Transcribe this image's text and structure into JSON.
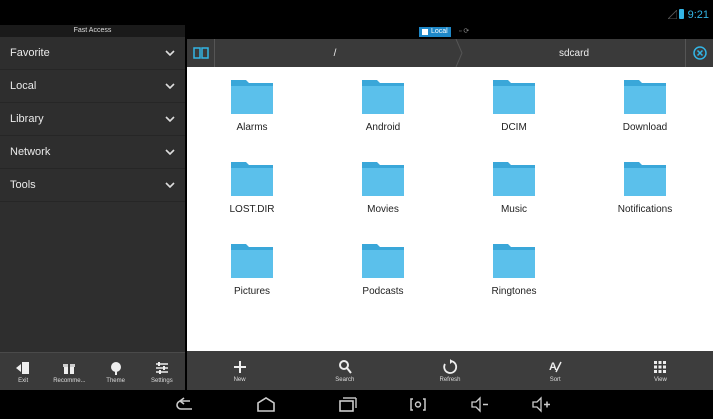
{
  "status": {
    "time": "9:21",
    "accent": "#33b5e5"
  },
  "left_panel": {
    "header": "Fast Access",
    "items": [
      {
        "label": "Favorite"
      },
      {
        "label": "Local"
      },
      {
        "label": "Library"
      },
      {
        "label": "Network"
      },
      {
        "label": "Tools"
      }
    ],
    "toolbar": [
      {
        "label": "Exit",
        "icon": "exit-icon"
      },
      {
        "label": "Recomme...",
        "icon": "gift-icon"
      },
      {
        "label": "Theme",
        "icon": "theme-icon"
      },
      {
        "label": "Settings",
        "icon": "settings-icon"
      }
    ]
  },
  "tabs": {
    "active": "Local"
  },
  "path": {
    "root": "/",
    "current": "sdcard"
  },
  "files": [
    {
      "name": "Alarms"
    },
    {
      "name": "Android"
    },
    {
      "name": "DCIM"
    },
    {
      "name": "Download"
    },
    {
      "name": "LOST.DIR"
    },
    {
      "name": "Movies"
    },
    {
      "name": "Music"
    },
    {
      "name": "Notifications"
    },
    {
      "name": "Pictures"
    },
    {
      "name": "Podcasts"
    },
    {
      "name": "Ringtones"
    }
  ],
  "bottom_toolbar": [
    {
      "label": "New",
      "icon": "plus-icon"
    },
    {
      "label": "Search",
      "icon": "search-icon"
    },
    {
      "label": "Refresh",
      "icon": "refresh-icon"
    },
    {
      "label": "Sort",
      "icon": "sort-icon"
    },
    {
      "label": "View",
      "icon": "grid-view-icon"
    }
  ],
  "colors": {
    "folder": "#5bc0eb",
    "folder_dark": "#3aa7d9"
  }
}
